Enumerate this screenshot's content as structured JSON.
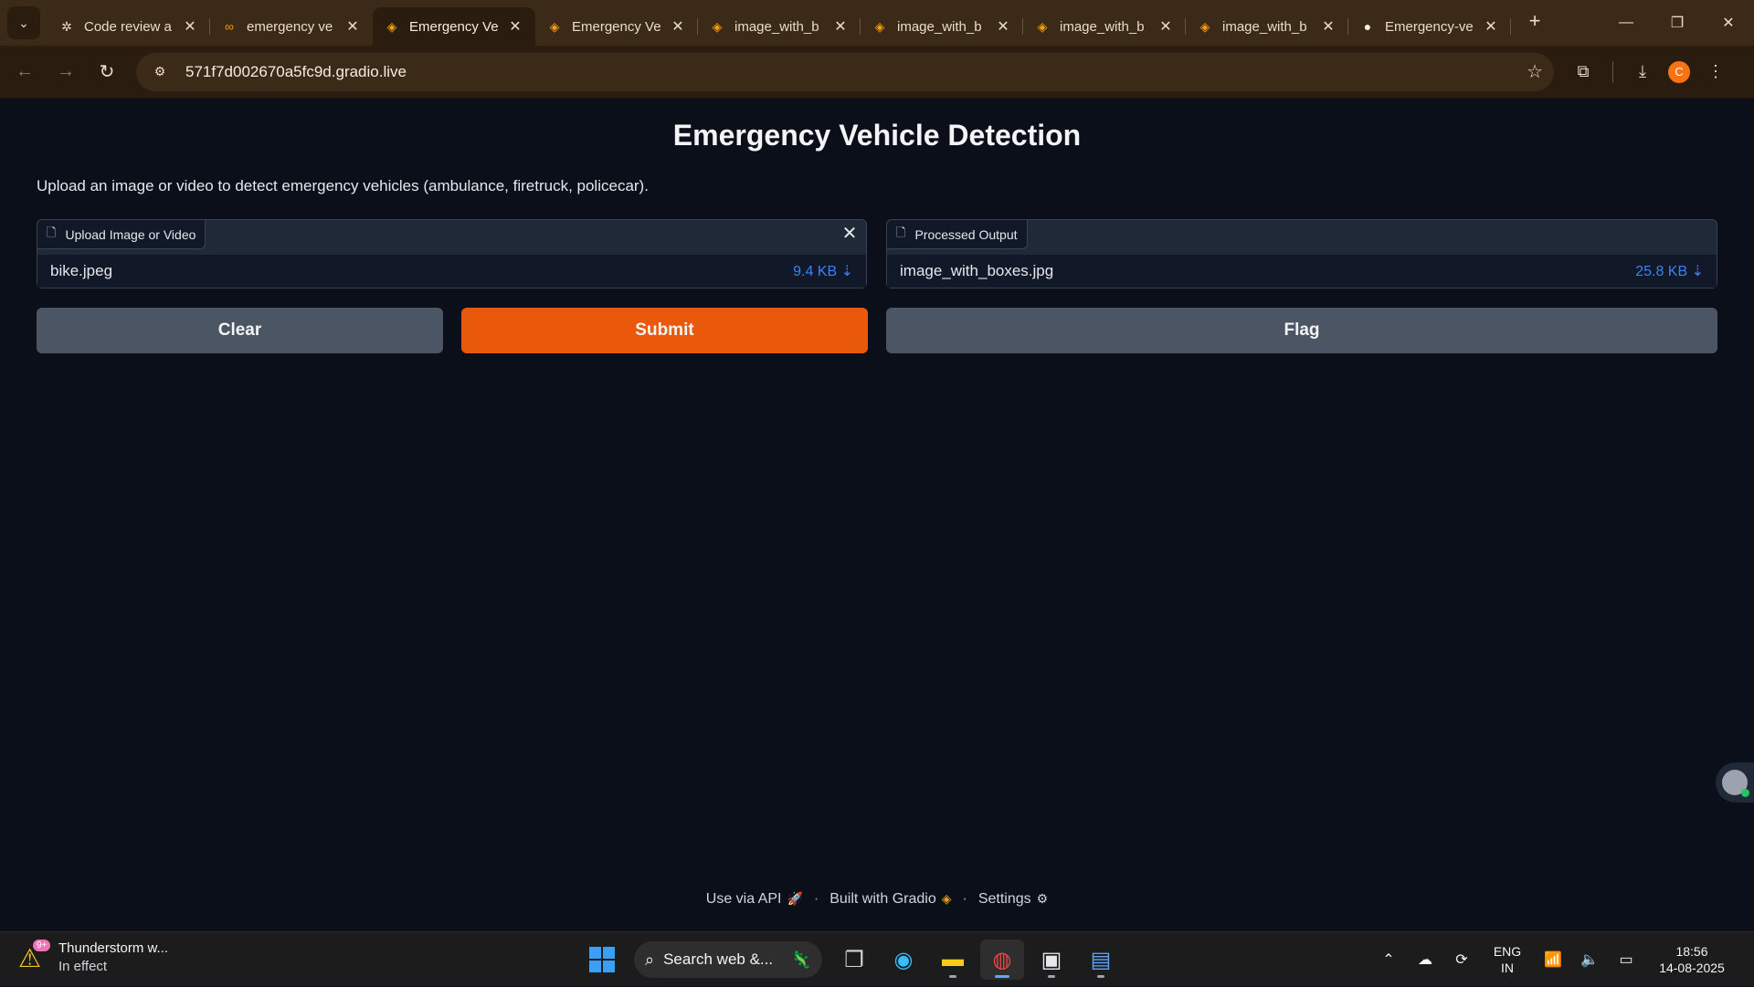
{
  "browser": {
    "tabs": [
      {
        "label": "Code review a",
        "icon": "openai-icon",
        "glyph": "✲",
        "color": "#e8dccb",
        "active": false
      },
      {
        "label": "emergency ve",
        "icon": "colab-icon",
        "glyph": "∞",
        "color": "#f59e0b",
        "active": false
      },
      {
        "label": "Emergency Ve",
        "icon": "gradio-icon",
        "glyph": "◈",
        "color": "#f59e0b",
        "active": true
      },
      {
        "label": "Emergency Ve",
        "icon": "gradio-icon",
        "glyph": "◈",
        "color": "#f59e0b",
        "active": false
      },
      {
        "label": "image_with_b",
        "icon": "gradio-icon",
        "glyph": "◈",
        "color": "#f59e0b",
        "active": false
      },
      {
        "label": "image_with_b",
        "icon": "gradio-icon",
        "glyph": "◈",
        "color": "#f59e0b",
        "active": false
      },
      {
        "label": "image_with_b",
        "icon": "gradio-icon",
        "glyph": "◈",
        "color": "#f59e0b",
        "active": false
      },
      {
        "label": "image_with_b",
        "icon": "gradio-icon",
        "glyph": "◈",
        "color": "#f59e0b",
        "active": false
      },
      {
        "label": "Emergency-ve",
        "icon": "github-icon",
        "glyph": "●",
        "color": "#f3ece2",
        "active": false
      }
    ],
    "url": "571f7d002670a5fc9d.gradio.live",
    "profile_initial": "C"
  },
  "app": {
    "title": "Emergency Vehicle Detection",
    "description": "Upload an image or video to detect emergency vehicles (ambulance, firetruck, policecar).",
    "input": {
      "label": "Upload Image or Video",
      "file_name": "bike.jpeg",
      "file_size": "9.4 KB ⇣"
    },
    "output": {
      "label": "Processed Output",
      "file_name": "image_with_boxes.jpg",
      "file_size": "25.8 KB ⇣"
    },
    "buttons": {
      "clear": "Clear",
      "submit": "Submit",
      "flag": "Flag"
    },
    "footer": {
      "api": "Use via API",
      "built": "Built with Gradio",
      "settings": "Settings"
    },
    "colors": {
      "primary": "#ea580c",
      "secondary": "#4b5563",
      "link": "#3b82f6"
    }
  },
  "taskbar": {
    "weather_title": "Thunderstorm w...",
    "weather_status": "In effect",
    "weather_badge": "9+",
    "search_placeholder": "Search web &...",
    "lang_line1": "ENG",
    "lang_line2": "IN",
    "time": "18:56",
    "date": "14-08-2025"
  }
}
